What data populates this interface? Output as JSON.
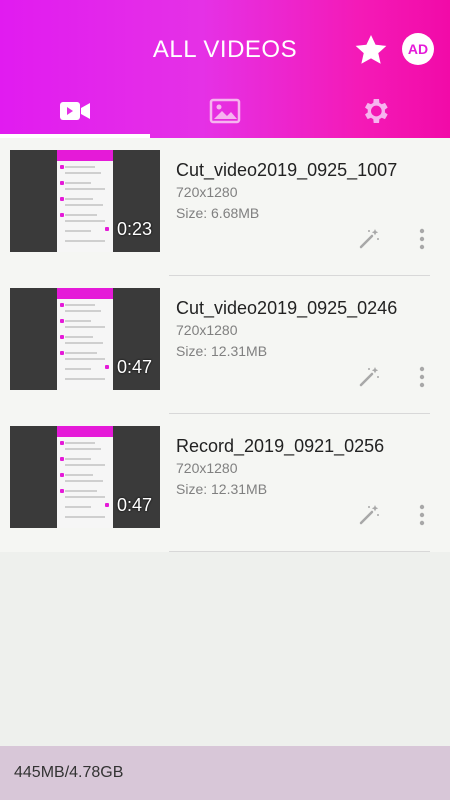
{
  "header": {
    "title": "ALL VIDEOS",
    "star_icon": "star-icon",
    "ad_label": "AD"
  },
  "tabs": [
    {
      "name": "videos",
      "icon": "video-camera-icon",
      "active": true
    },
    {
      "name": "images",
      "icon": "image-icon",
      "active": false
    },
    {
      "name": "settings",
      "icon": "gear-icon",
      "active": false
    }
  ],
  "videos": [
    {
      "name": "Cut_video2019_0925_1007",
      "resolution": "720x1280",
      "size": "Size: 6.68MB",
      "duration": "0:23"
    },
    {
      "name": "Cut_video2019_0925_0246",
      "resolution": "720x1280",
      "size": "Size: 12.31MB",
      "duration": "0:47"
    },
    {
      "name": "Record_2019_0921_0256",
      "resolution": "720x1280",
      "size": "Size: 12.31MB",
      "duration": "0:47"
    }
  ],
  "footer": {
    "storage": "445MB/4.78GB"
  },
  "colors": {
    "accent": "#e51ad8",
    "header_start": "#e11bf0",
    "header_end": "#f20aa8",
    "footer_bg": "#d8c7d8"
  }
}
